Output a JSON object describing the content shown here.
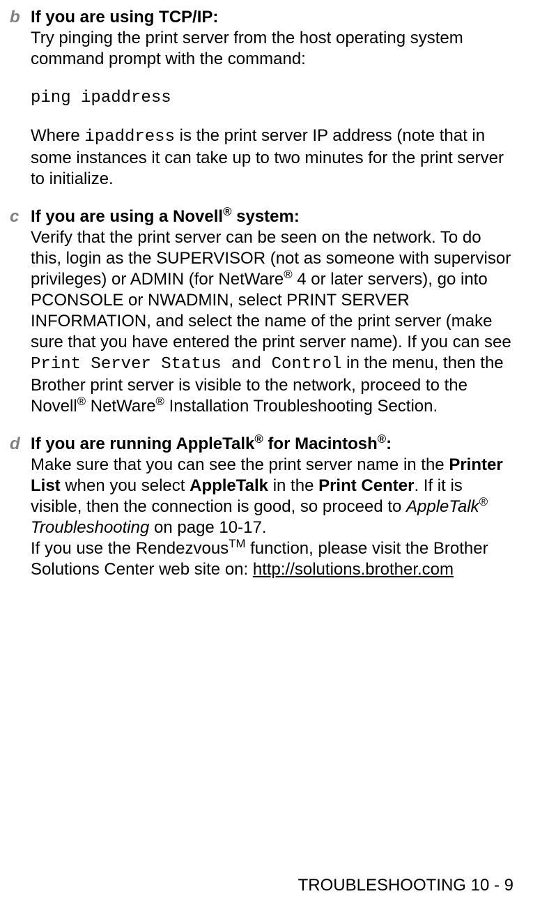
{
  "sections": {
    "b": {
      "letter": "b",
      "title": "If you are using TCP/IP:",
      "body1": "Try pinging the print server from the host operating system command prompt with the command:",
      "command": "ping ipaddress",
      "body2_pre": "Where ",
      "body2_mono": "ipaddress",
      "body2_post": " is the print server IP address (note that in some instances it can take up to two minutes for the print server to initialize."
    },
    "c": {
      "letter": "c",
      "title_pre": "If you are using a Novell",
      "title_sup": "®",
      "title_post": " system:",
      "body1_pre": "Verify that the print server can be seen on the network. To do this, login as the SUPERVISOR (not as someone with supervisor privileges) or ADMIN (for NetWare",
      "body1_sup": "®",
      "body1_mid": " 4 or later servers), go into PCONSOLE or NWADMIN, select PRINT SERVER INFORMATION, and select the name of the print server (make sure that you have entered the print server name). If you can see ",
      "body1_mono": "Print Server Status and Control",
      "body1_mid2": " in the menu, then the Brother print server is visible to the network, proceed to the Novell",
      "body1_sup2": "®",
      "body1_mid3": " NetWare",
      "body1_sup3": "®",
      "body1_end": " Installation Troubleshooting Section."
    },
    "d": {
      "letter": "d",
      "title_pre": "If you are running AppleTalk",
      "title_sup": "®",
      "title_mid": " for Macintosh",
      "title_sup2": "®",
      "title_post": ":",
      "body1_pre": "Make sure that you can see the print server name in the ",
      "body1_b1": "Printer List",
      "body1_mid1": " when you select ",
      "body1_b2": "AppleTalk",
      "body1_mid2": " in the ",
      "body1_b3": "Print Center",
      "body1_mid3": ". If it is visible, then the connection is good, so proceed to ",
      "body1_italic_pre": "AppleTalk",
      "body1_italic_sup": "®",
      "body1_italic_post": " Troubleshooting",
      "body1_mid4": " on page 10-17.",
      "body2_pre": "If you use the Rendezvous",
      "body2_sup": "TM",
      "body2_mid": " function, please visit the Brother Solutions Center web site on: ",
      "body2_link": "http://solutions.brother.com"
    }
  },
  "footer": "TROUBLESHOOTING 10 - 9"
}
